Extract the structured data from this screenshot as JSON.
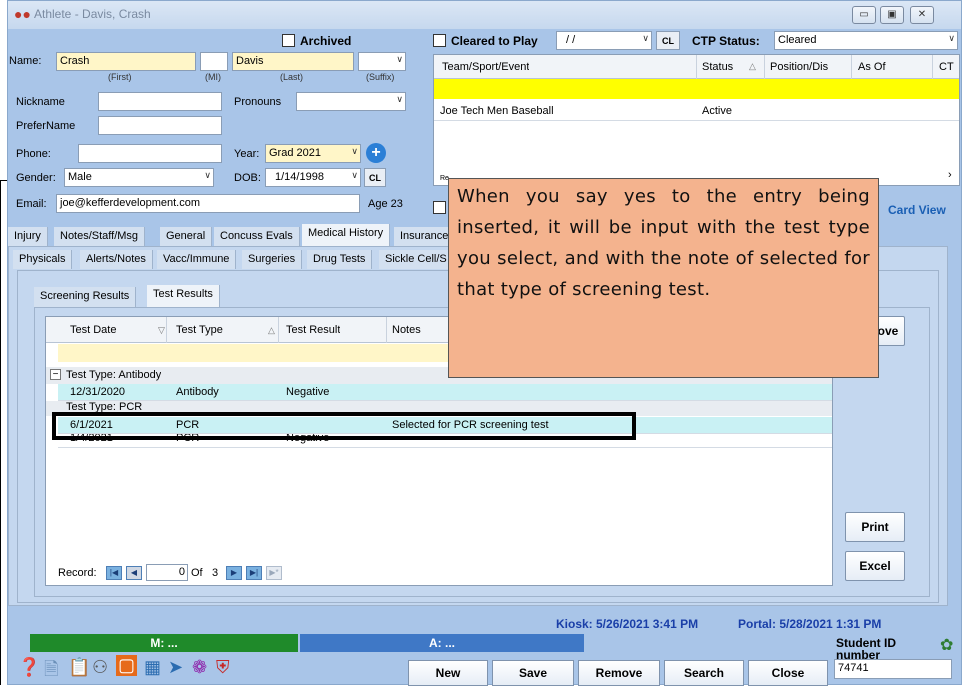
{
  "window": {
    "title": "Athlete - Davis, Crash",
    "min": "▭",
    "max": "▣",
    "close": "✕"
  },
  "athlete": {
    "archived_label": "Archived",
    "name_label": "Name:",
    "first": "Crash",
    "mi": "",
    "last": "Davis",
    "suffix": "",
    "first_caption": "(First)",
    "mi_caption": "(MI)",
    "last_caption": "(Last)",
    "suffix_caption": "(Suffix)",
    "nickname_label": "Nickname",
    "nickname": "",
    "pronouns_label": "Pronouns",
    "pronouns": "",
    "prefername_label": "PreferName",
    "prefername": "",
    "phone_label": "Phone:",
    "phone": "",
    "year_label": "Year:",
    "year": "Grad 2021",
    "gender_label": "Gender:",
    "gender": "Male",
    "dob_label": "DOB:",
    "dob": "1/14/1998",
    "cl_label": "CL",
    "email_label": "Email:",
    "email": "joe@kefferdevelopment.com",
    "age": "Age 23"
  },
  "clearance": {
    "cleared_label": "Cleared to Play",
    "cleared_date": "/   /",
    "cl_label": "CL",
    "ctp_status_label": "CTP Status:",
    "ctp_status": "Cleared",
    "columns": [
      "Team/Sport/Event",
      "Status",
      "Position/Dis",
      "As Of",
      "CT"
    ],
    "rows": [
      {
        "team": "Joe Tech Men Baseball",
        "status": "Active"
      }
    ],
    "record_prefix": "Re",
    "card_view_label": "Card View"
  },
  "main_tabs": [
    "Injury",
    "Notes/Staff/Msg",
    "General",
    "Concuss Evals",
    "Medical History",
    "Insurance"
  ],
  "sub_tabs": [
    "Physicals",
    "Alerts/Notes",
    "Vacc/Immune",
    "Surgeries",
    "Drug Tests",
    "Sickle Cell/S"
  ],
  "screen_tabs": [
    "Screening Results",
    "Test Results"
  ],
  "test_grid": {
    "columns": [
      "Test Date",
      "Test Type",
      "Test Result",
      "Notes"
    ],
    "group1": "Test Type: Antibody",
    "group2": "Test Type: PCR",
    "group_toggle": "−",
    "rows": [
      {
        "date": "12/31/2020",
        "type": "Antibody",
        "result": "Negative",
        "notes": ""
      },
      {
        "date": "6/1/2021",
        "type": "PCR",
        "result": "",
        "notes": "Selected for PCR screening test"
      },
      {
        "date": "1/4/2021",
        "type": "PCR",
        "result": "Negative",
        "notes": ""
      }
    ],
    "record_label": "Record:",
    "record_current": "0",
    "record_of": "Of",
    "record_total": "3"
  },
  "side_buttons": {
    "remove": "Remove",
    "print": "Print",
    "excel": "Excel"
  },
  "callout": "When you say yes to the entry being inserted, it will be input with the test type you select, and with the note of selected for that type of screening test.",
  "status": {
    "kiosk": "Kiosk: 5/26/2021 3:41 PM",
    "portal": "Portal: 5/28/2021 1:31 PM",
    "m_label": "M: ...",
    "a_label": "A: ...",
    "student_id_label": "Student ID number",
    "student_id": "74741"
  },
  "bottom_buttons": {
    "new": "New",
    "save": "Save",
    "remove": "Remove",
    "search": "Search",
    "close": "Close"
  },
  "colors": {
    "highlight_row": "#c9f1f4",
    "yellow_row": "#ffff00",
    "callout": "#f4b38e",
    "m_bar": "#1f8a2a",
    "a_bar": "#3f78c6"
  }
}
